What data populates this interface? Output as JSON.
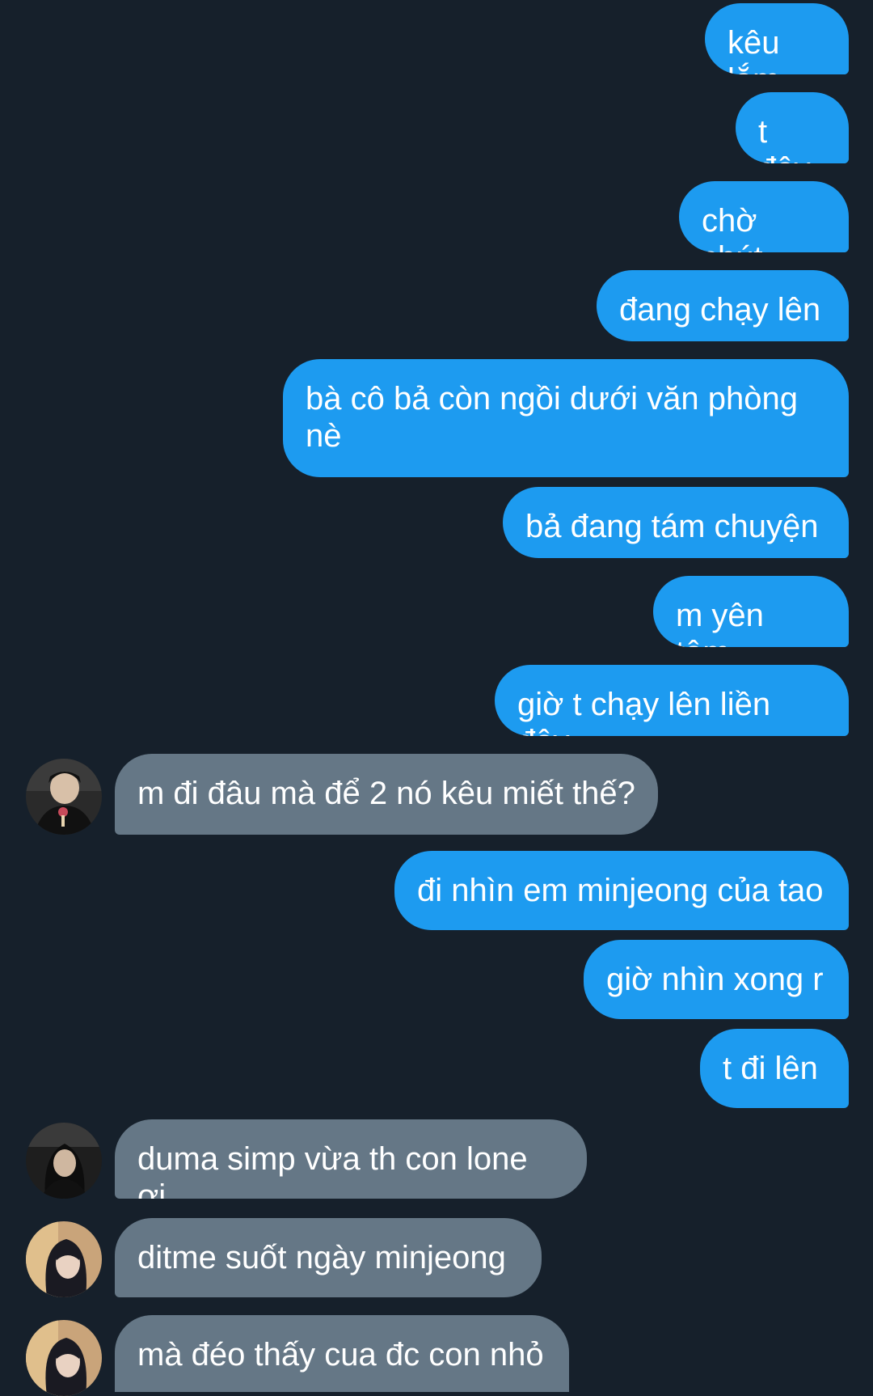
{
  "conversation": {
    "messages": [
      {
        "side": "out",
        "text": "kêu lắm"
      },
      {
        "side": "out",
        "text": "t đây"
      },
      {
        "side": "out",
        "text": "chờ chút"
      },
      {
        "side": "out",
        "text": "đang chạy lên"
      },
      {
        "side": "out",
        "text": "bà cô bả còn ngồi dưới văn phòng nè"
      },
      {
        "side": "out",
        "text": "bả đang tám chuyện"
      },
      {
        "side": "out",
        "text": "m yên tâm"
      },
      {
        "side": "out",
        "text": "giờ t chạy lên liền đây"
      },
      {
        "side": "in",
        "text": "m đi đâu mà để 2 nó kêu miết thế?",
        "avatar": "avatar-boy"
      },
      {
        "side": "out",
        "text": "đi nhìn em minjeong của tao"
      },
      {
        "side": "out",
        "text": "giờ nhìn xong r"
      },
      {
        "side": "out",
        "text": "t đi lên"
      },
      {
        "side": "in",
        "text": "duma simp vừa th con lone ơi",
        "avatar": "avatar-girl-dark"
      },
      {
        "side": "in",
        "text": "ditme suốt ngày minjeong",
        "avatar": "avatar-girl-light"
      },
      {
        "side": "in",
        "text": "mà đéo thấy cua đc con nhỏ",
        "avatar": "avatar-girl-light"
      }
    ]
  },
  "colors": {
    "background": "#16202b",
    "outgoing_bubble": "#1d9bf0",
    "incoming_bubble": "#657786",
    "text": "#ffffff"
  }
}
